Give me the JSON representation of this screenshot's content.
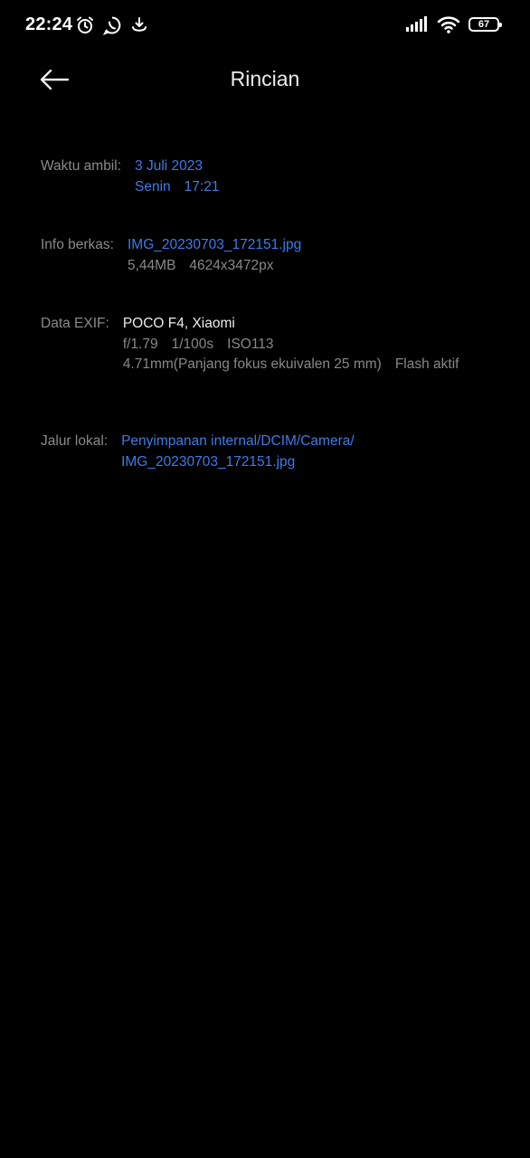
{
  "status_bar": {
    "time": "22:24",
    "battery_level": "67",
    "left_icons": [
      "alarm-icon",
      "whatsapp-icon",
      "download-icon"
    ],
    "right_icons": [
      "signal-icon",
      "wifi-icon",
      "battery-icon"
    ]
  },
  "header": {
    "title": "Rincian",
    "back_icon": "arrow-left-icon"
  },
  "details": {
    "waktu": {
      "label": "Waktu ambil:",
      "date": "3 Juli 2023",
      "day": "Senin",
      "time": "17:21"
    },
    "info": {
      "label": "Info berkas:",
      "filename": "IMG_20230703_172151.jpg",
      "size": "5,44MB",
      "resolution": "4624x3472px"
    },
    "exif": {
      "label": "Data EXIF:",
      "device": "POCO F4, Xiaomi",
      "aperture": "f/1.79",
      "shutter": "1/100s",
      "iso": "ISO113",
      "focal": "4.71mm(Panjang fokus ekuivalen 25 mm)",
      "flash": "Flash aktif"
    },
    "jalur": {
      "label": "Jalur lokal:",
      "path_line1": "Penyimpanan internal/DCIM/Camera/",
      "path_line2": "IMG_20230703_172151.jpg"
    }
  },
  "colors": {
    "background": "#000000",
    "link_blue": "#3e7be6",
    "label_grey": "#8a8a8a",
    "text_white": "#ececec"
  }
}
